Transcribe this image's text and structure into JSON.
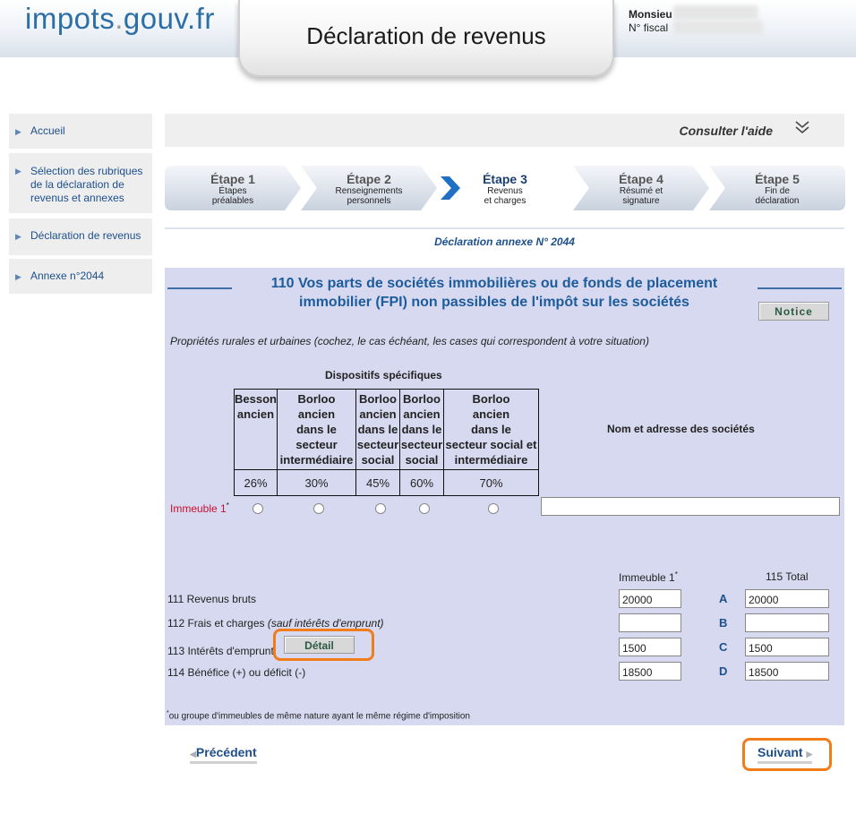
{
  "header": {
    "logo_main": "impots",
    "logo_dot": ".",
    "logo_tail": "gouv.fr",
    "title": "Déclaration de revenus",
    "user_label": "Monsieu",
    "fiscal_label": "N° fiscal"
  },
  "sidebar": {
    "items": [
      {
        "label": "Accueil"
      },
      {
        "label": "Sélection des rubriques de la déclaration de revenus et annexes"
      },
      {
        "label": "Déclaration de revenus"
      },
      {
        "label": "Annexe n°2044"
      }
    ]
  },
  "help": {
    "label": "Consulter l'aide"
  },
  "steps": [
    {
      "title": "Étape 1",
      "sub1": "Étapes",
      "sub2": "préalables"
    },
    {
      "title": "Étape 2",
      "sub1": "Renseignements",
      "sub2": "personnels"
    },
    {
      "title": "Étape 3",
      "sub1": "Revenus",
      "sub2": "et charges",
      "active": true
    },
    {
      "title": "Étape 4",
      "sub1": "Résumé et",
      "sub2": "signature"
    },
    {
      "title": "Étape 5",
      "sub1": "Fin de",
      "sub2": "déclaration"
    }
  ],
  "annexe_title": "Déclaration annexe N° 2044",
  "section": {
    "title_line1": "110 Vos parts de sociétés immobilières ou de fonds de placement",
    "title_line2": "immobilier (FPI) non passibles de l'impôt sur les sociétés",
    "notice_button": "Notice",
    "intro": "Propriétés rurales et urbaines (cochez, le cas échéant, les cases qui correspondent à votre situation)",
    "dispositifs_title": "Dispositifs spécifiques",
    "table_headers": [
      [
        "Besson",
        "ancien"
      ],
      [
        "Borloo",
        "ancien",
        "dans le",
        "secteur",
        "intermédiaire"
      ],
      [
        "Borloo",
        "ancien",
        "dans le",
        "secteur",
        "social"
      ],
      [
        "Borloo",
        "ancien",
        "dans le",
        "secteur",
        "social"
      ],
      [
        "Borloo",
        "ancien",
        "dans le",
        "secteur social et",
        "intermédiaire"
      ]
    ],
    "table_rates": [
      "26%",
      "30%",
      "45%",
      "60%",
      "70%"
    ],
    "nom_header": "Nom et adresse des sociétés",
    "immeuble_label": "Immeuble 1",
    "asterisk": "*"
  },
  "amounts": {
    "col_immeuble": "Immeuble 1",
    "col_total": "115 Total",
    "rows": [
      {
        "label": "111 Revenus bruts",
        "immeuble": "20000",
        "letter": "A",
        "total": "20000"
      },
      {
        "label": "112 Frais et charges",
        "label_italic": "(sauf intérêts d'emprunt)",
        "immeuble": "",
        "letter": "B",
        "total": ""
      },
      {
        "label": "113 Intérêts d'emprunt",
        "immeuble": "1500",
        "letter": "C",
        "total": "1500"
      },
      {
        "label": "114 Bénéfice (+) ou déficit (-)",
        "immeuble": "18500",
        "letter": "D",
        "total": "18500"
      }
    ],
    "detail_button": "Détail",
    "footnote": "ou groupe d'immeubles de même nature ayant le même régime d'imposition"
  },
  "nav": {
    "previous": "Précédent",
    "next": "Suivant"
  },
  "colors": {
    "accent": "#1d4f8c",
    "panel": "#d6d9ef",
    "highlight": "#f07c1a",
    "required": "#c8102e"
  }
}
